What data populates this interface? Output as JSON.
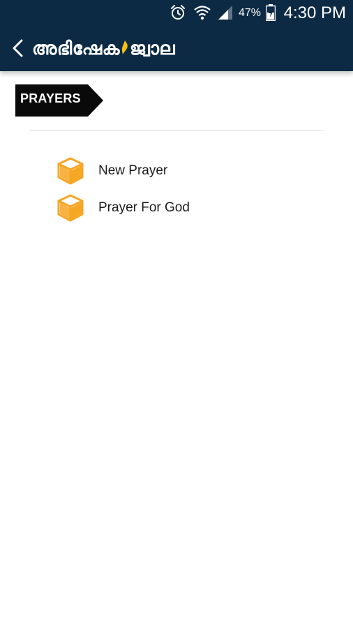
{
  "status_bar": {
    "icons": [
      "alarm-icon",
      "wifi-icon",
      "signal-icon",
      "battery-icon"
    ],
    "battery_percent": "47%",
    "time": "4:30 PM"
  },
  "app_bar": {
    "back_icon": "chevron-left-icon",
    "logo_text_part1": "അഭിഷേക",
    "logo_text_part2": "ജ്വാല",
    "logo_flame_color": "#f4c20d",
    "background_color": "#0c2a44"
  },
  "section": {
    "label": "PRAYERS"
  },
  "prayers": {
    "items": [
      {
        "label": "New Prayer",
        "icon": "cube-icon"
      },
      {
        "label": "Prayer For God",
        "icon": "cube-icon"
      }
    ],
    "icon_color": "#f5a623"
  }
}
